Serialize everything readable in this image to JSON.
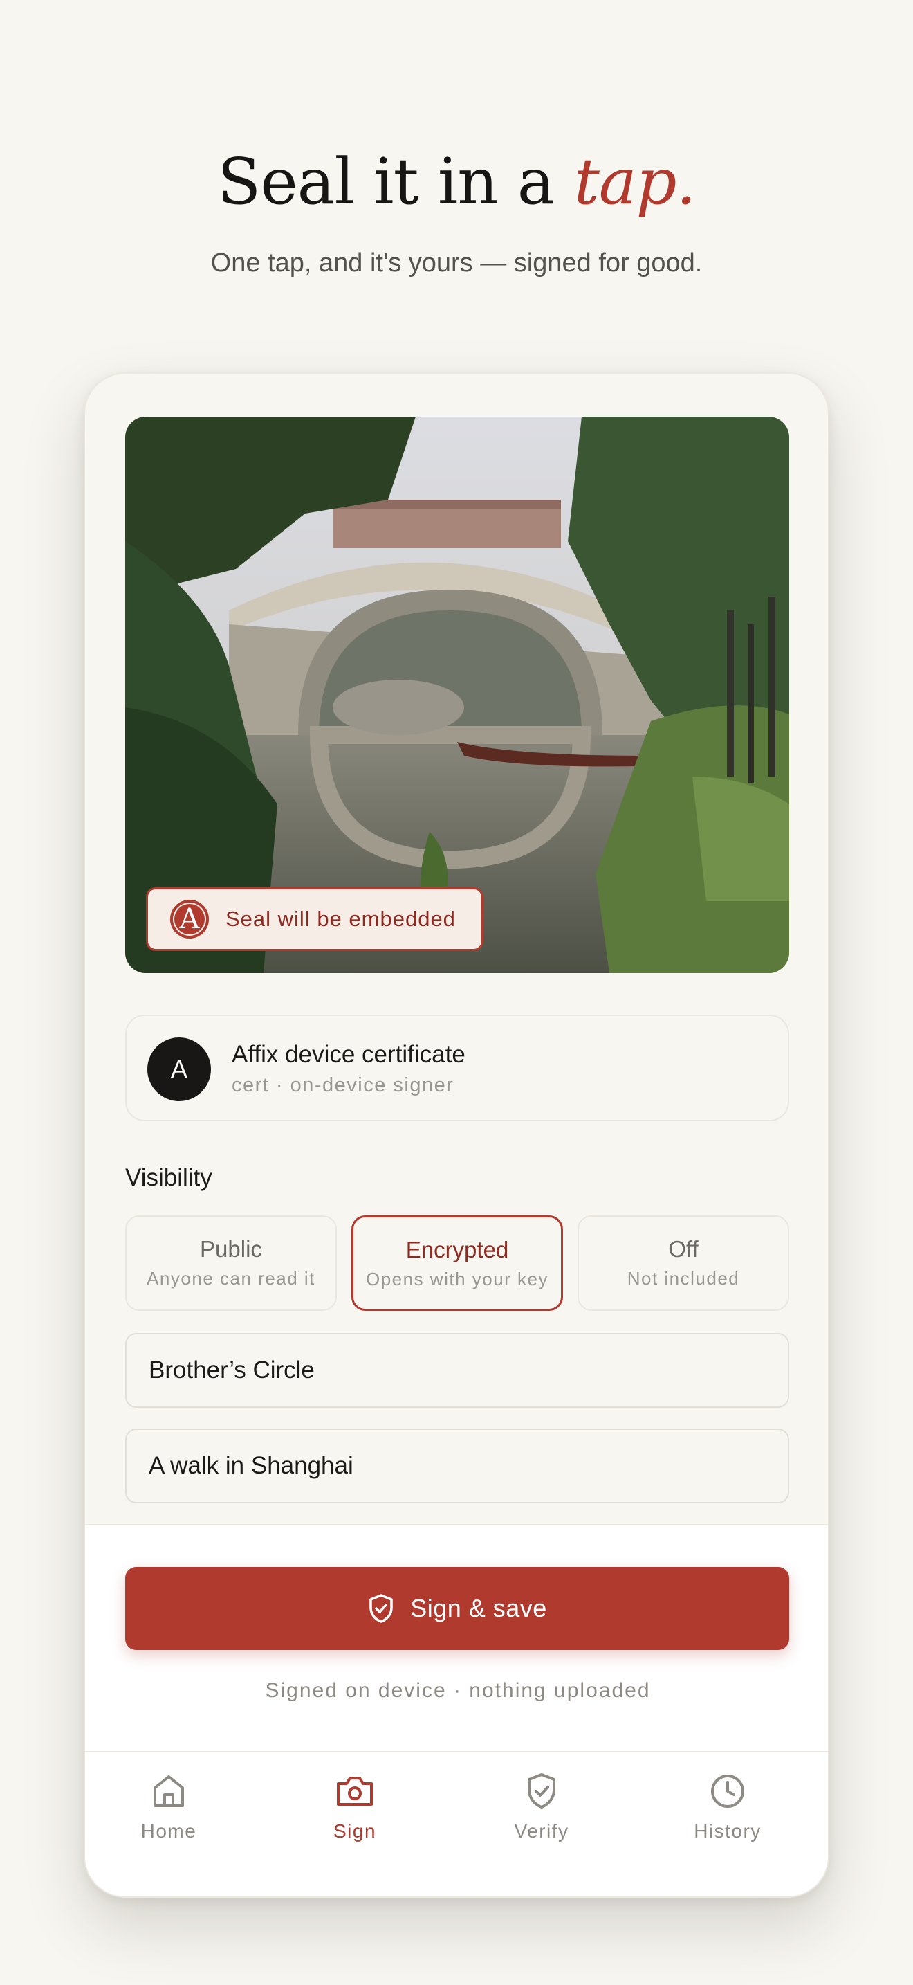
{
  "hero": {
    "title_prefix": "Seal it in a ",
    "title_accent": "tap.",
    "subtitle": "One tap, and it's yours — signed for good."
  },
  "photo": {
    "alt": "Stone arch bridge reflected in pond",
    "seal_badge": {
      "icon_letter": "A",
      "label": "Seal will be embedded"
    }
  },
  "certificate": {
    "avatar_letter": "A",
    "title": "Affix device certificate",
    "subtitle": "cert · on-device signer"
  },
  "visibility": {
    "label": "Visibility",
    "options": [
      {
        "title": "Public",
        "subtitle": "Anyone can read it",
        "selected": false
      },
      {
        "title": "Encrypted",
        "subtitle": "Opens with your key",
        "selected": true
      },
      {
        "title": "Off",
        "subtitle": "Not included",
        "selected": false
      }
    ]
  },
  "fields": {
    "circle": "Brother’s Circle",
    "caption": "A walk in Shanghai"
  },
  "action": {
    "button_label": "Sign & save",
    "button_icon": "shield-check-icon",
    "note": "Signed on device · nothing uploaded"
  },
  "tabs": [
    {
      "label": "Home",
      "icon": "home-icon",
      "active": false
    },
    {
      "label": "Sign",
      "icon": "camera-icon",
      "active": true
    },
    {
      "label": "Verify",
      "icon": "shield-check-icon",
      "active": false
    },
    {
      "label": "History",
      "icon": "clock-icon",
      "active": false
    }
  ],
  "colors": {
    "accent": "#b03a2e",
    "background": "#f8f6f1",
    "text": "#1b1a18",
    "muted": "#8d8a83"
  }
}
